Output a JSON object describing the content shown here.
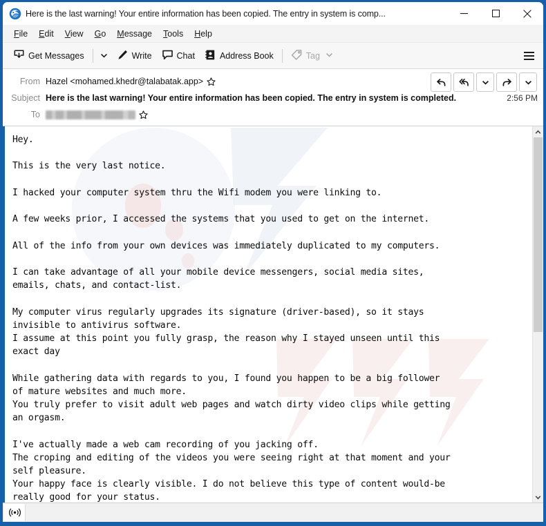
{
  "window": {
    "title": "Here is the last warning! Your entire information has been copied. The entry in system is comp...",
    "app_icon": "thunderbird-icon",
    "controls": {
      "minimize": "minimize-icon",
      "maximize": "maximize-icon",
      "close": "close-icon"
    },
    "accent_color": "#1560a8"
  },
  "menubar": {
    "items": [
      {
        "label": "File",
        "accesskey": "F"
      },
      {
        "label": "Edit",
        "accesskey": "E"
      },
      {
        "label": "View",
        "accesskey": "V"
      },
      {
        "label": "Go",
        "accesskey": "G"
      },
      {
        "label": "Message",
        "accesskey": "M"
      },
      {
        "label": "Tools",
        "accesskey": "T"
      },
      {
        "label": "Help",
        "accesskey": "H"
      }
    ]
  },
  "toolbar": {
    "get_messages": "Get Messages",
    "get_messages_icon": "inbox-download-icon",
    "get_messages_chevron": "chevron-down-icon",
    "write": "Write",
    "write_icon": "pencil-icon",
    "chat": "Chat",
    "chat_icon": "speech-bubble-icon",
    "address_book": "Address Book",
    "address_book_icon": "address-card-icon",
    "tag": "Tag",
    "tag_icon": "tag-icon",
    "tag_chevron": "chevron-down-icon",
    "tag_disabled": true,
    "app_menu_icon": "hamburger-menu-icon"
  },
  "message": {
    "from_label": "From",
    "from_value": "Hazel <mohamed.khedr@talabatak.app>",
    "from_star_icon": "star-icon",
    "subject_label": "Subject",
    "subject_value": "Here is the last warning! Your entire information has been copied. The entry in system is completed.",
    "time": "2:56 PM",
    "to_label": "To",
    "to_value_redacted": true,
    "to_star_icon": "star-icon",
    "actions": [
      {
        "name": "reply-button",
        "icon": "reply-arrow-icon"
      },
      {
        "name": "reply-all-button",
        "icon": "reply-all-arrow-icon"
      },
      {
        "name": "reply-more-button",
        "icon": "chevron-down-icon"
      },
      {
        "name": "forward-button",
        "icon": "forward-arrow-icon"
      },
      {
        "name": "more-actions-button",
        "icon": "chevron-down-icon"
      }
    ],
    "body": "Hey.\n\nThis is the very last notice.\n\nI hacked your computer system thru the Wifi modem you were linking to.\n\nA few weeks prior, I accessed the systems that you used to get on the internet.\n\nAll of the info from your own devices was immediately duplicated to my computers.\n\nI can take advantage of all your mobile device messengers, social media sites,\nemails, chats, and contact-list.\n\nMy computer virus regularly upgrades its signature (driver-based), so it stays\ninvisible to antivirus software.\nI assume at this point you fully grasp, the reason why I stayed unseen until this\nexact day\n\nWhile gathering data with regards to you, I found you happen to be a big follower\nof mature websites and much more.\nYou truly prefer to visit adult web pages and watch dirty video clips while getting\nan orgasm.\n\nI've actually made a web cam recording of you jacking off.\nThe croping and editing of the videos you were seeing right at that moment and your\nself pleasure.\nYour happy face is clearly visible. I do not believe this type of content would-be\nreally good for your status."
  },
  "scrollbar": {
    "up_icon": "chevron-up-icon",
    "down_icon": "chevron-down-icon",
    "thumb_position": "top",
    "thumb_size_percent": 55
  },
  "statusbar": {
    "icon": "broadcast-signal-icon",
    "text": ""
  }
}
